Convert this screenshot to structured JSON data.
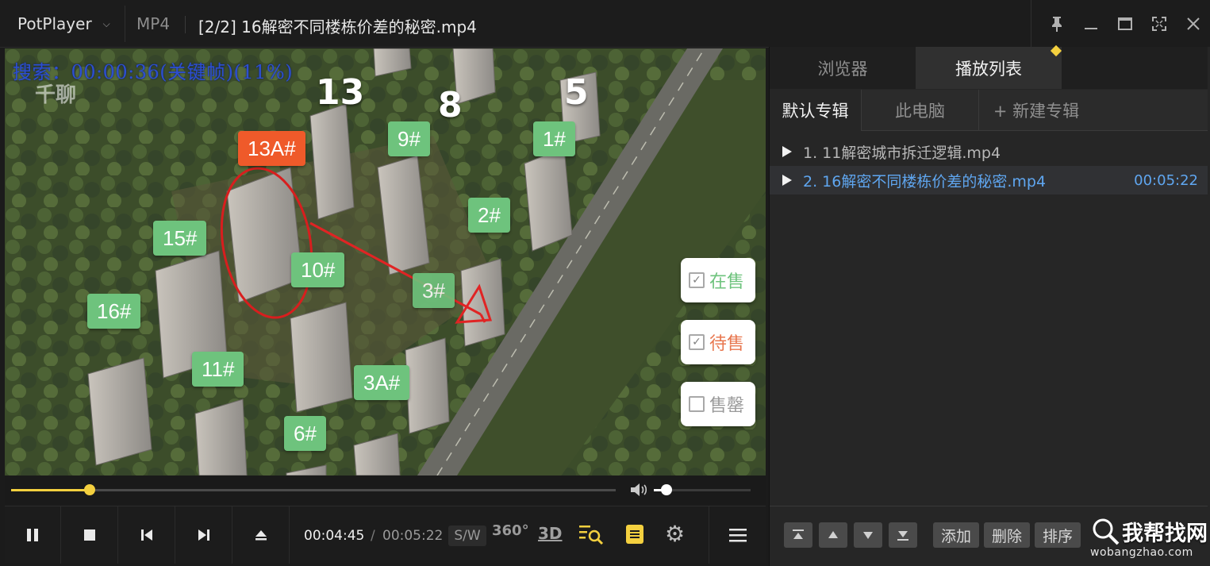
{
  "titlebar": {
    "app_name": "PotPlayer",
    "format": "MP4",
    "file_title": "[2/2] 16解密不同楼栋价差的秘密.mp4"
  },
  "video": {
    "osd_text": "搜索：00:00:36(关键帧)(11%)",
    "watermark": "千聊",
    "block_numbers": [
      "13",
      "8",
      "5"
    ],
    "building_tags": [
      "13A#",
      "9#",
      "1#",
      "15#",
      "2#",
      "10#",
      "3#",
      "16#",
      "11#",
      "3A#",
      "6#"
    ],
    "legend": [
      {
        "label": "在售",
        "checked": true,
        "color": "#6ec37d"
      },
      {
        "label": "待售",
        "checked": true,
        "color": "#e8774f"
      },
      {
        "label": "售罄",
        "checked": false,
        "color": "#9a9a9a"
      }
    ],
    "seek_progress": 0.13,
    "volume_level": 0.13
  },
  "controls": {
    "current_time": "00:04:45",
    "separator": "/",
    "total_time": "00:05:22",
    "sw_label": "S/W",
    "label_360": "360°",
    "label_3d": "3D"
  },
  "panel": {
    "tabs": [
      {
        "label": "浏览器",
        "active": false
      },
      {
        "label": "播放列表",
        "active": true
      }
    ],
    "album_tabs": [
      {
        "label": "默认专辑",
        "active": true
      },
      {
        "label": "此电脑",
        "active": false
      },
      {
        "label": "+ 新建专辑",
        "active": false
      }
    ],
    "playlist": [
      {
        "label": "1. 11解密城市拆迁逻辑.mp4",
        "duration": "",
        "current": false
      },
      {
        "label": "2. 16解密不同楼栋价差的秘密.mp4",
        "duration": "00:05:22",
        "current": true
      }
    ],
    "footer_buttons": [
      "添加",
      "删除",
      "排序"
    ],
    "site_name": "我帮找网",
    "site_url": "wobangzhao.com"
  },
  "colors": {
    "accent": "#f4d03f",
    "playing": "#5fa6f0",
    "tag_green": "#6ec37d",
    "tag_orange": "#ef5a2a"
  }
}
